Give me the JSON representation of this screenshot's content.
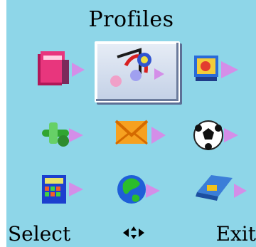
{
  "header": {
    "title": "Profiles"
  },
  "menu": {
    "items": [
      {
        "icon": "book-icon",
        "selected": false
      },
      {
        "icon": "music-notes-icon",
        "selected": true
      },
      {
        "icon": "video-icon",
        "selected": false
      },
      {
        "icon": "tools-icon",
        "selected": false
      },
      {
        "icon": "envelope-icon",
        "selected": false
      },
      {
        "icon": "soccer-ball-icon",
        "selected": false
      },
      {
        "icon": "calculator-icon",
        "selected": false
      },
      {
        "icon": "globe-icon",
        "selected": false
      },
      {
        "icon": "card-icon",
        "selected": false
      }
    ]
  },
  "softkeys": {
    "left": "Select",
    "right": "Exit"
  },
  "colors": {
    "background": "#8ed6e8",
    "arrow": "#d48ee8"
  }
}
